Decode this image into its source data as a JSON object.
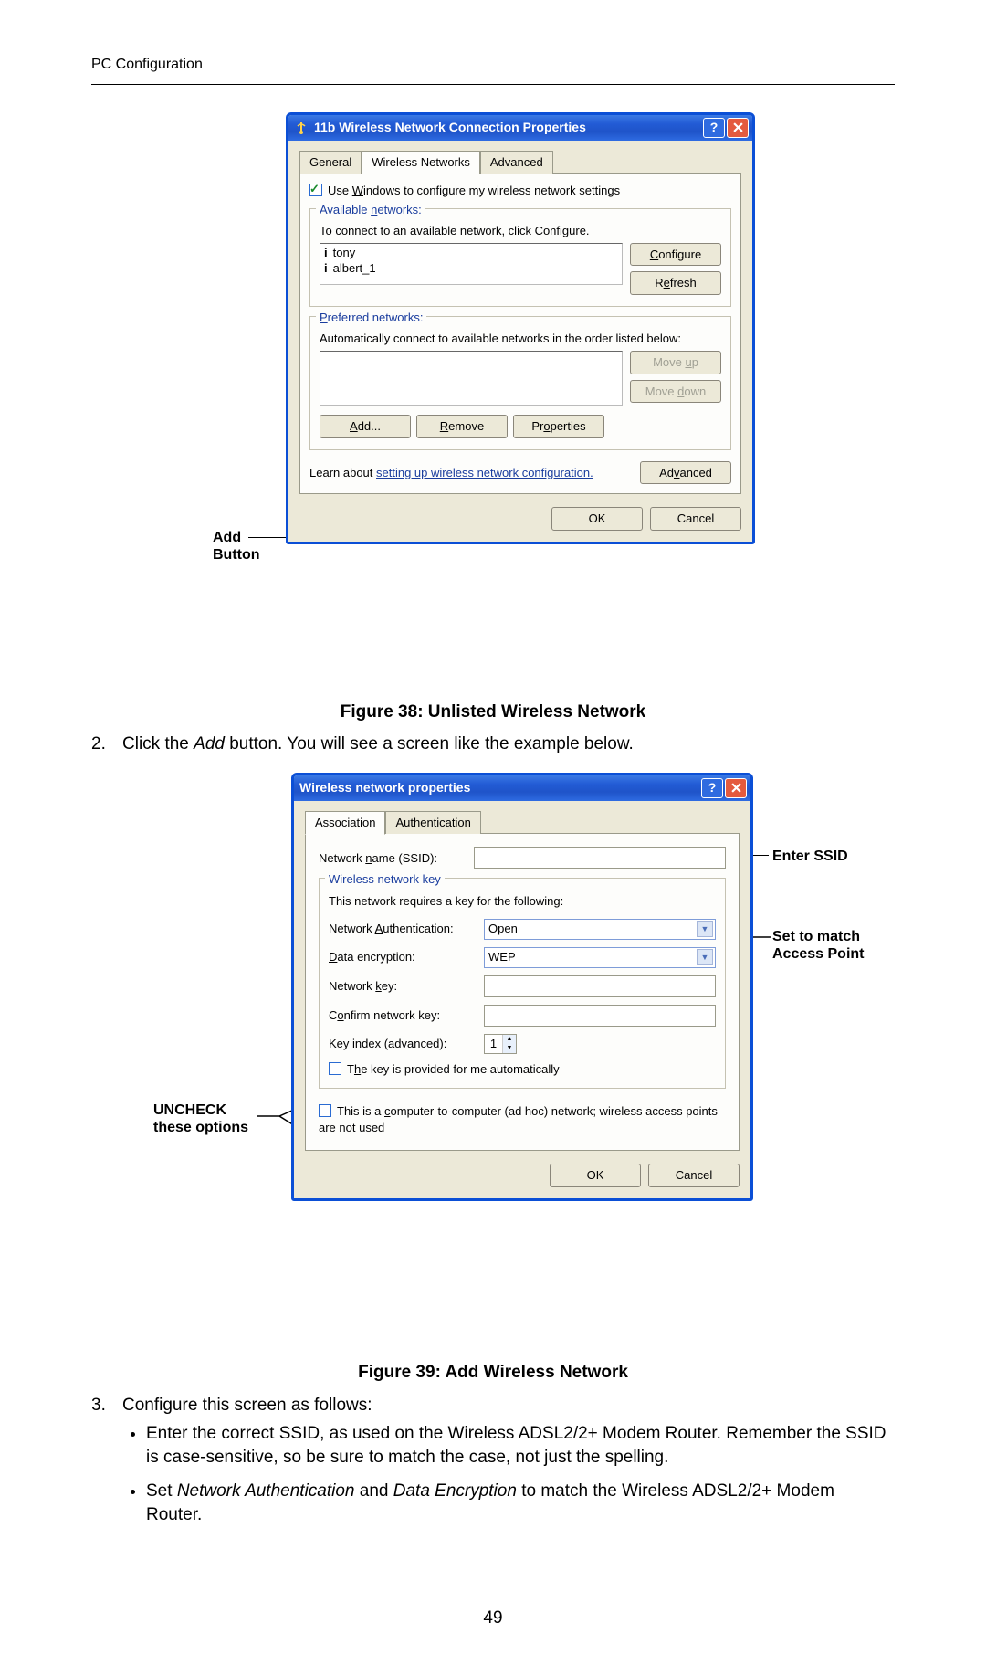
{
  "header": {
    "running_head": "PC Configuration",
    "page_number": "49"
  },
  "fig1": {
    "external_label_l1": "Add",
    "external_label_l2": "Button",
    "win_title": "11b Wireless Network Connection Properties",
    "tabs": {
      "general": "General",
      "wireless": "Wireless Networks",
      "advanced": "Advanced"
    },
    "use_windows_pre": "Use ",
    "use_windows_u": "W",
    "use_windows_post": "indows to configure my wireless network settings",
    "avail_label_pre": "Available ",
    "avail_label_u": "n",
    "avail_label_post": "etworks:",
    "avail_help": "To connect to an available network, click Configure.",
    "avail_items": [
      "tony",
      "albert_1"
    ],
    "btn_configure_u": "C",
    "btn_configure_post": "onfigure",
    "btn_refresh_pre": "R",
    "btn_refresh_u": "e",
    "btn_refresh_post": "fresh",
    "pref_label_u": "P",
    "pref_label_post": "referred networks:",
    "pref_help": "Automatically connect to available networks in the order listed below:",
    "btn_moveup_pre": "Move ",
    "btn_moveup_u": "u",
    "btn_moveup_post": "p",
    "btn_movedown_pre": "Move ",
    "btn_movedown_u": "d",
    "btn_movedown_post": "own",
    "btn_add_u": "A",
    "btn_add_post": "dd...",
    "btn_remove_u": "R",
    "btn_remove_post": "emove",
    "btn_properties_pre": "Pr",
    "btn_properties_u": "o",
    "btn_properties_post": "perties",
    "learn_pre": "Learn about ",
    "learn_link": "setting up wireless network configuration.",
    "btn_advanced_pre": "Ad",
    "btn_advanced_u": "v",
    "btn_advanced_post": "anced",
    "btn_ok": "OK",
    "btn_cancel": "Cancel",
    "caption": "Figure 38: Unlisted Wireless Network"
  },
  "step2_num": "2.",
  "step2_pre": "Click the ",
  "step2_em": "Add",
  "step2_post": " button. You will see a screen like the example below.",
  "fig2": {
    "callout_enter": "Enter SSID",
    "callout_match_l1": "Set to match",
    "callout_match_l2": "Access Point",
    "callout_uncheck_l1": "UNCHECK",
    "callout_uncheck_l2": "these options",
    "win_title": "Wireless network properties",
    "tabs": {
      "assoc": "Association",
      "auth": "Authentication"
    },
    "ssid_lbl_pre": "Network ",
    "ssid_lbl_u": "n",
    "ssid_lbl_post": "ame (SSID):",
    "group_legend": "Wireless network key",
    "group_help": "This network requires a key for the following:",
    "auth_lbl_pre": "Network ",
    "auth_lbl_u": "A",
    "auth_lbl_post": "uthentication:",
    "auth_value": "Open",
    "enc_lbl_u": "D",
    "enc_lbl_post": "ata encryption:",
    "enc_value": "WEP",
    "key_lbl_pre": "Network ",
    "key_lbl_u": "k",
    "key_lbl_post": "ey:",
    "confirm_lbl_pre": "C",
    "confirm_lbl_u": "o",
    "confirm_lbl_post": "nfirm network key:",
    "idx_lbl": "Key index (advanced):",
    "idx_value": "1",
    "auto_pre": "T",
    "auto_u": "h",
    "auto_post": "e key is provided for me automatically",
    "adhoc_pre": "This is a ",
    "adhoc_u": "c",
    "adhoc_post": "omputer-to-computer (ad hoc) network; wireless access points are not used",
    "btn_ok": "OK",
    "btn_cancel": "Cancel",
    "caption": "Figure 39: Add Wireless Network"
  },
  "step3_num": "3.",
  "step3": "Configure this screen as follows:",
  "bullet1": "Enter the correct SSID, as used on the Wireless ADSL2/2+ Modem Router. Remember the SSID is case-sensitive, so be sure to match the case, not just the spelling.",
  "bullet2_pre": "Set ",
  "bullet2_em1": "Network Authentication",
  "bullet2_mid": " and ",
  "bullet2_em2": "Data Encryption",
  "bullet2_post": " to match the Wireless ADSL2/2+ Modem Router."
}
